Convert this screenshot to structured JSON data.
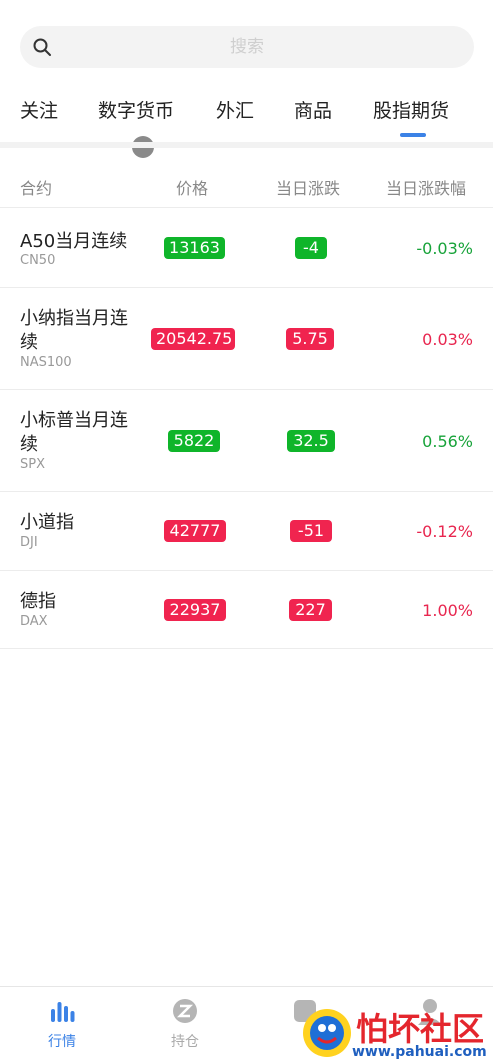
{
  "search": {
    "placeholder": "搜索"
  },
  "tabs": [
    "关注",
    "数字货币",
    "外汇",
    "商品",
    "股指期货"
  ],
  "active_tab": "股指期货",
  "columns": {
    "contract": "合约",
    "price": "价格",
    "change": "当日涨跌",
    "change_pct": "当日涨跌幅"
  },
  "rows": [
    {
      "name": "A50当月连续",
      "code": "CN50",
      "price": "13163",
      "change": "-4",
      "pct": "-0.03%",
      "color": "green"
    },
    {
      "name": "小纳指当月连续",
      "code": "NAS100",
      "price": "20542.75",
      "change": "5.75",
      "pct": "0.03%",
      "color": "red"
    },
    {
      "name": "小标普当月连续",
      "code": "SPX",
      "price": "5822",
      "change": "32.5",
      "pct": "0.56%",
      "color": "green"
    },
    {
      "name": "小道指",
      "code": "DJI",
      "price": "42777",
      "change": "-51",
      "pct": "-0.12%",
      "color": "red"
    },
    {
      "name": "德指",
      "code": "DAX",
      "price": "22937",
      "change": "227",
      "pct": "1.00%",
      "color": "red"
    }
  ],
  "bottom_nav": [
    {
      "label": "行情",
      "icon": "bar-chart-icon",
      "active": true
    },
    {
      "label": "持仓",
      "icon": "position-icon",
      "active": false
    },
    {
      "label": "",
      "icon": "square-icon",
      "active": false
    },
    {
      "label": "",
      "icon": "user-icon",
      "active": false
    }
  ],
  "watermark": {
    "text": "怕坏社区",
    "url": "www.pahuai.com"
  },
  "colors": {
    "accent": "#3b82e6",
    "up": "#f0244f",
    "down": "#0fb52a"
  }
}
